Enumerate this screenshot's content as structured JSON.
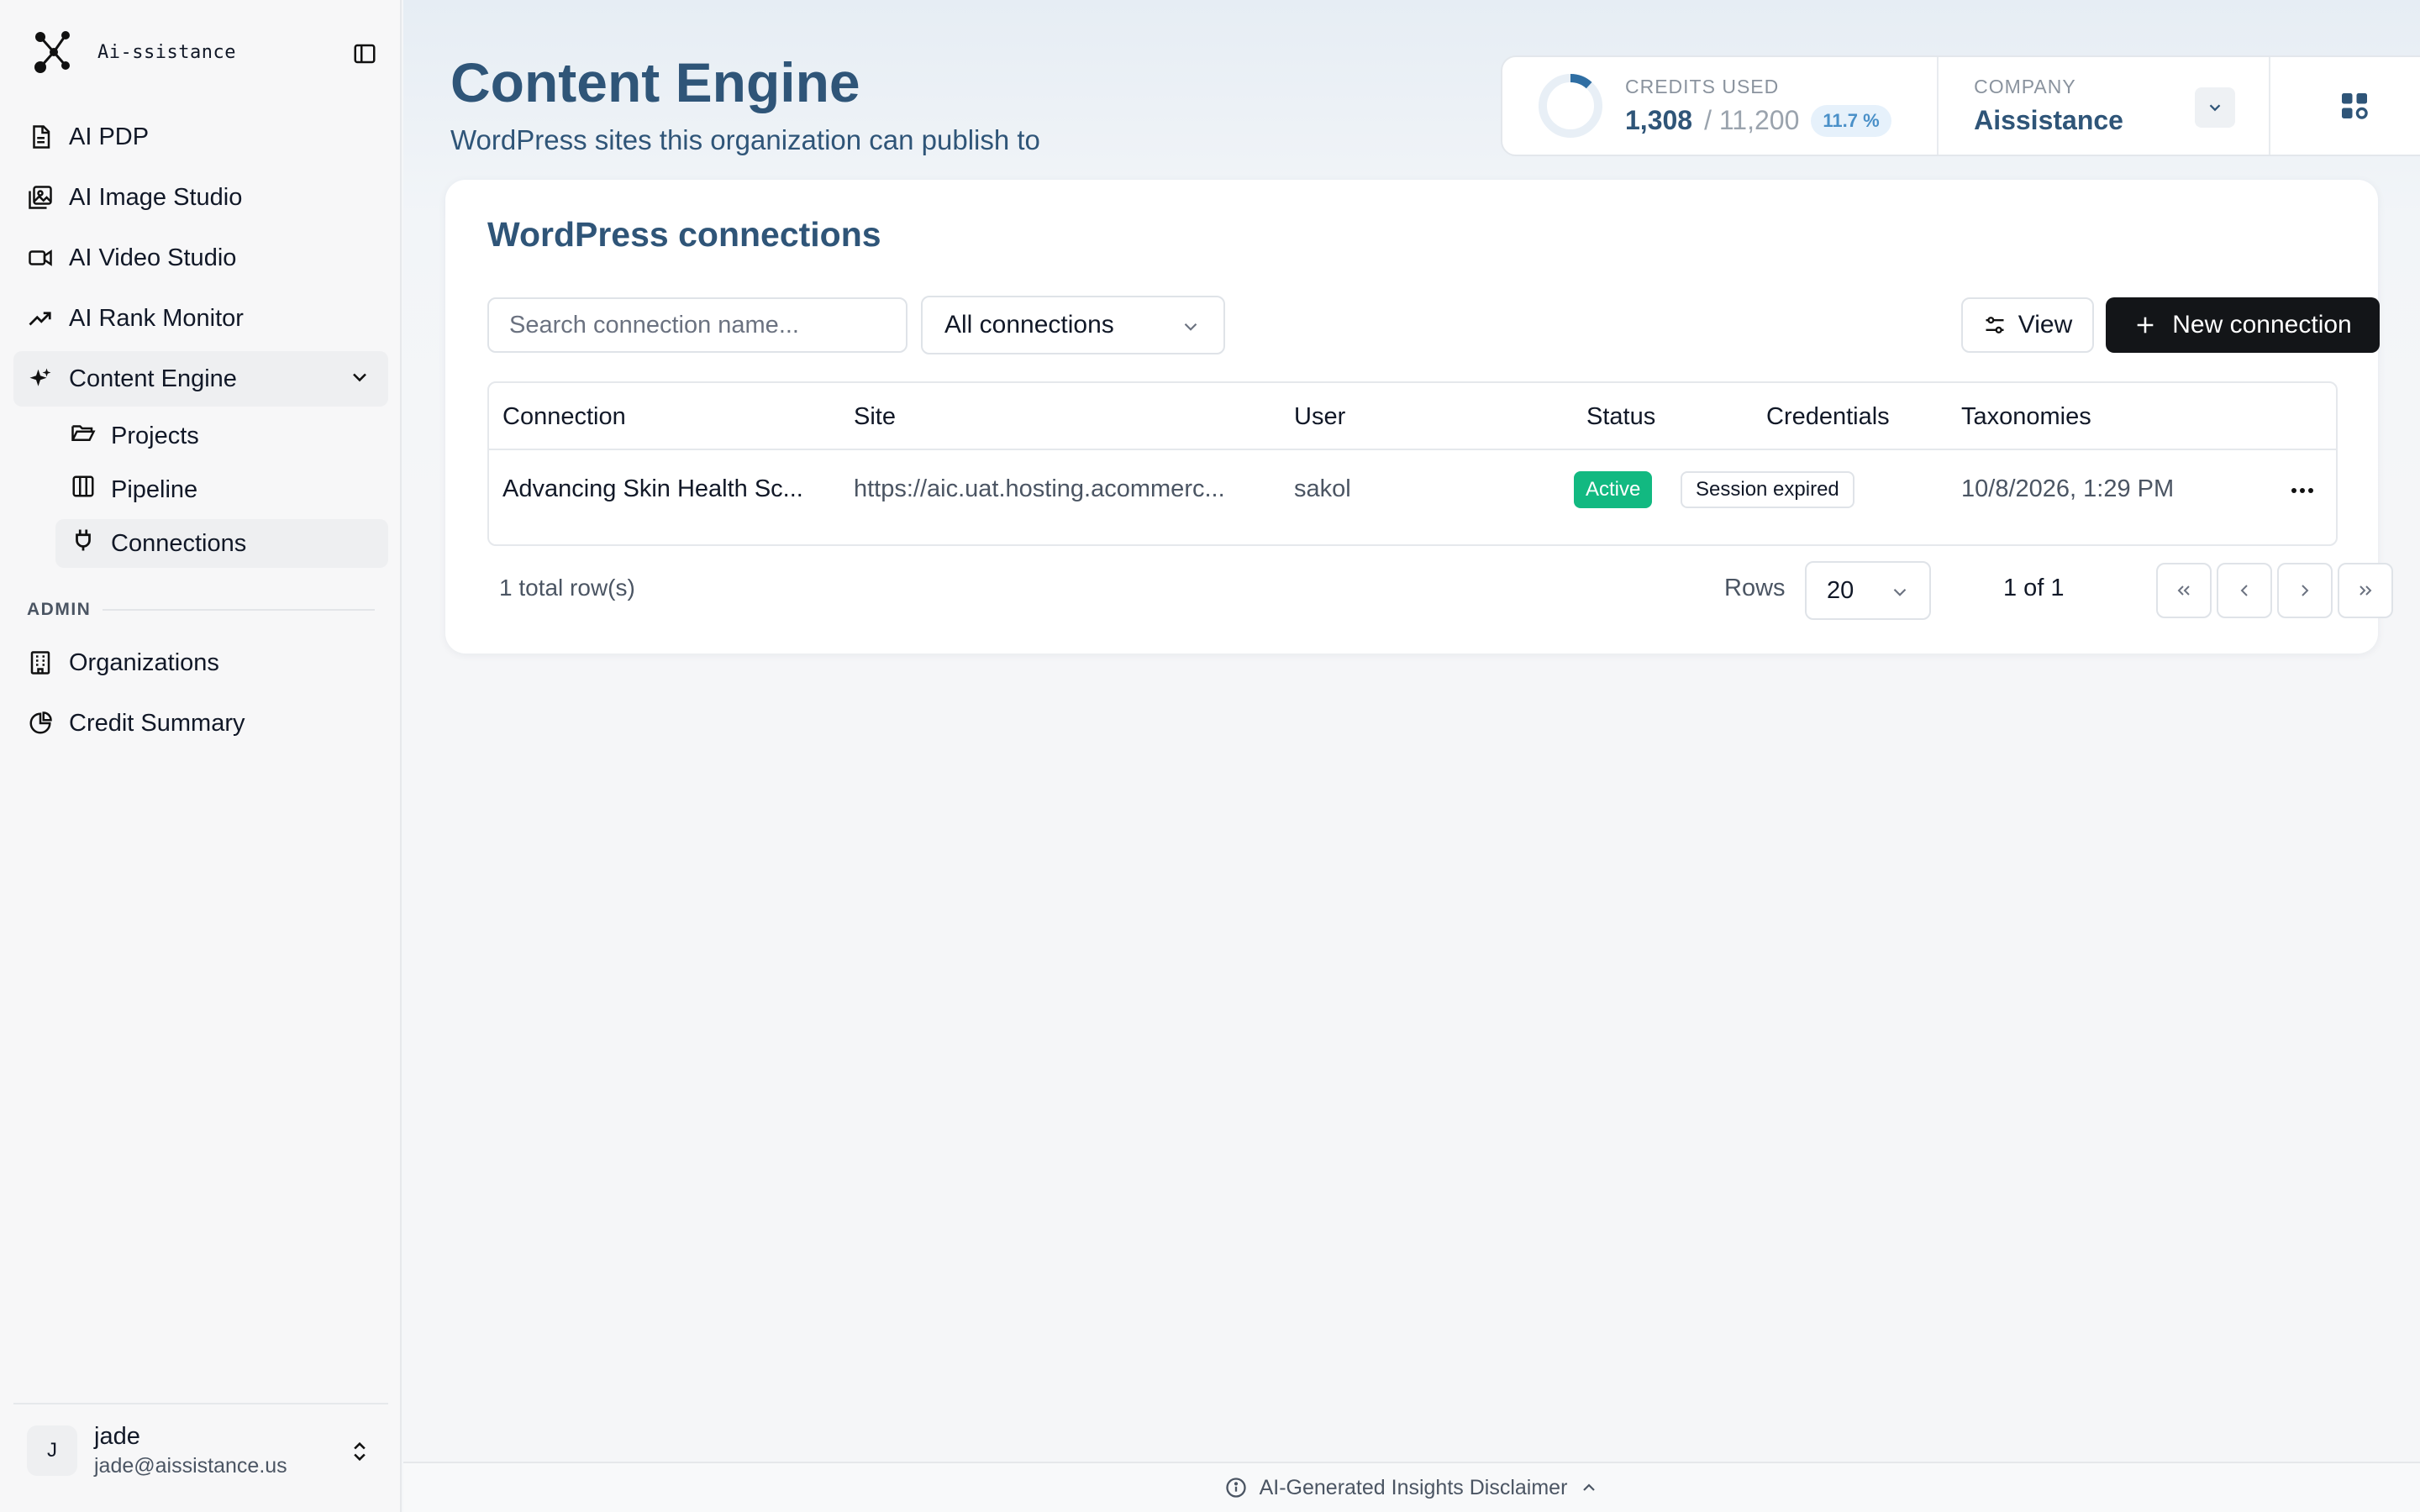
{
  "brand": {
    "name": "Ai-ssistance"
  },
  "sidebar": {
    "items": [
      {
        "label": "AI PDP",
        "icon": "document-icon"
      },
      {
        "label": "AI Image Studio",
        "icon": "image-gallery-icon"
      },
      {
        "label": "AI Video Studio",
        "icon": "video-camera-icon"
      },
      {
        "label": "AI Rank Monitor",
        "icon": "trend-up-icon"
      },
      {
        "label": "Content Engine",
        "icon": "sparkles-icon",
        "expanded": true
      }
    ],
    "sub_items": [
      {
        "label": "Projects",
        "icon": "folder-open-icon"
      },
      {
        "label": "Pipeline",
        "icon": "columns-icon"
      },
      {
        "label": "Connections",
        "icon": "plug-icon",
        "active": true
      }
    ],
    "admin_label": "ADMIN",
    "admin_items": [
      {
        "label": "Organizations",
        "icon": "building-icon"
      },
      {
        "label": "Credit Summary",
        "icon": "pie-chart-icon"
      }
    ],
    "user": {
      "initial": "J",
      "name": "jade",
      "email": "jade@aissistance.us"
    }
  },
  "header": {
    "title": "Content Engine",
    "subtitle": "WordPress sites this organization can publish to"
  },
  "stats": {
    "credits_label": "CREDITS USED",
    "credits_used": "1,308",
    "credits_total": "/ 11,200",
    "credits_percent": "11.7 %",
    "credits_fraction": 0.117,
    "company_label": "COMPANY",
    "company_name": "Aissistance"
  },
  "card": {
    "title": "WordPress connections",
    "search_placeholder": "Search connection name...",
    "filter_value": "All connections",
    "view_label": "View",
    "new_label": "New connection"
  },
  "table": {
    "columns": [
      "Connection",
      "Site",
      "User",
      "Status",
      "Credentials",
      "Taxonomies"
    ],
    "rows": [
      {
        "connection": "Advancing Skin Health Sc...",
        "site": "https://aic.uat.hosting.acommerc...",
        "user": "sakol",
        "status": "Active",
        "credentials": "Session expired",
        "taxonomies": "10/8/2026, 1:29 PM"
      }
    ]
  },
  "pagination": {
    "total": "1 total row(s)",
    "rows_label": "Rows",
    "rows_value": "20",
    "page_info": "1 of 1"
  },
  "footer": {
    "disclaimer": "AI-Generated Insights Disclaimer"
  },
  "colors": {
    "accent": "#2f5578",
    "active_badge": "#12b981",
    "primary_button": "#131518",
    "ring": "#2f6ea3"
  }
}
